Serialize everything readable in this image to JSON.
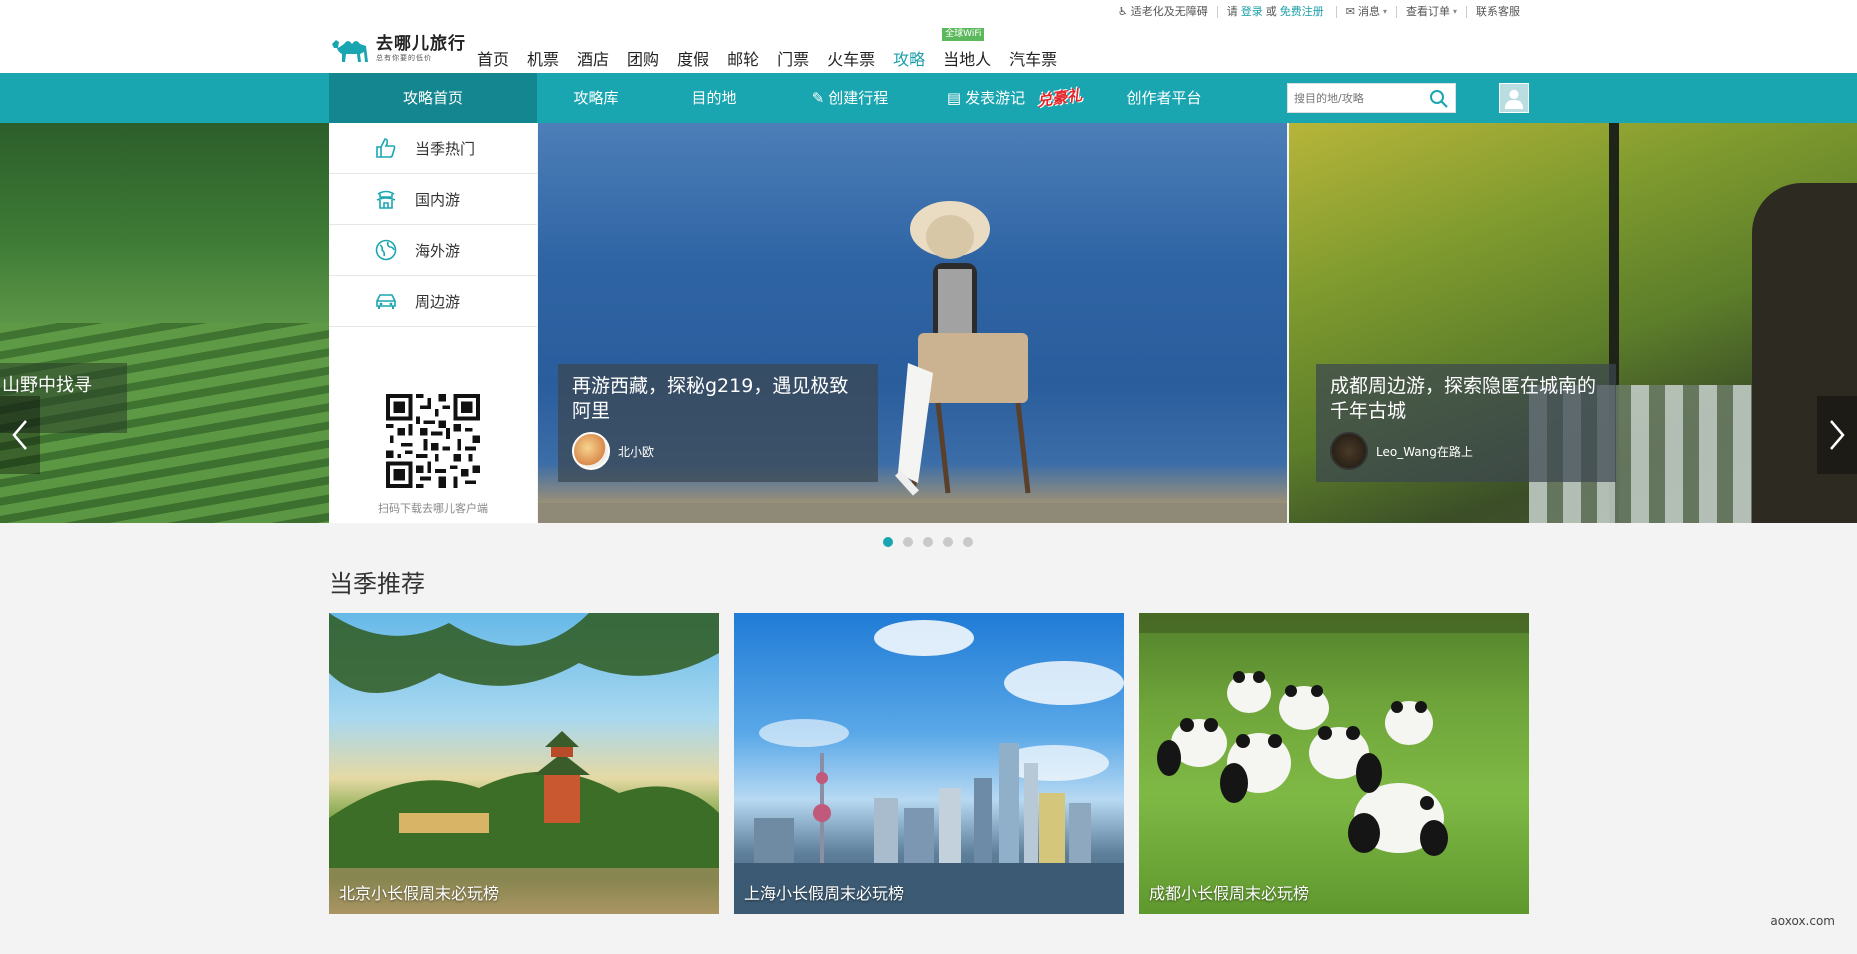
{
  "utility": {
    "accessibility": "适老化及无障碍",
    "please": "请",
    "login": "登录",
    "or": "或",
    "register": "免费注册",
    "messages": "消息",
    "orders": "查看订单",
    "contact": "联系客服"
  },
  "brand": {
    "name": "去哪儿旅行",
    "slogan": "总有你要的低价"
  },
  "main_nav": {
    "items": [
      "首页",
      "机票",
      "酒店",
      "团购",
      "度假",
      "邮轮",
      "门票",
      "火车票",
      "攻略",
      "当地人",
      "汽车票"
    ],
    "active": "攻略",
    "wifi_badge": "全球WiFi"
  },
  "sub_nav": {
    "home": "攻略首页",
    "library": "攻略库",
    "destinations": "目的地",
    "create_trip": "创建行程",
    "post_travelogue": "发表游记",
    "gift": "兑豪礼",
    "creator_platform": "创作者平台",
    "search_placeholder": "搜目的地/攻略"
  },
  "side_menu": {
    "items": [
      "当季热门",
      "国内游",
      "海外游",
      "周边游"
    ],
    "qr_caption": "扫码下载去哪儿客户端"
  },
  "banner": {
    "left_caption": "山野中找寻",
    "main": {
      "title": "再游西藏，探秘g219，遇见极致阿里",
      "author": "北小欧"
    },
    "right": {
      "title": "成都周边游，探索隐匿在城南的千年古城",
      "author": "Leo_Wang在路上"
    }
  },
  "section": {
    "title": "当季推荐",
    "cards": [
      "北京小长假周末必玩榜",
      "上海小长假周末必玩榜",
      "成都小长假周末必玩榜"
    ]
  },
  "watermark": "aoxox.com",
  "colors": {
    "teal": "#1aa6b1",
    "teal_dark": "#13868f",
    "link": "#1a9fa8",
    "gift_red": "#e4252a"
  }
}
